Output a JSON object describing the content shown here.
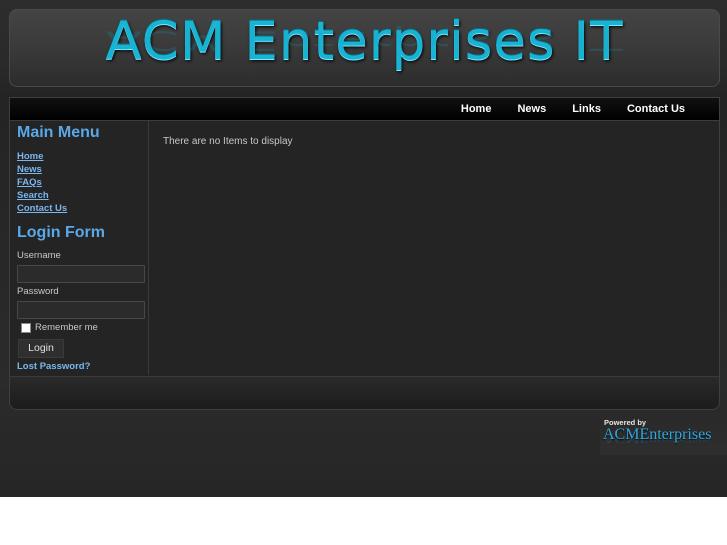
{
  "header": {
    "site_title": "ACM Enterprises IT"
  },
  "nav": {
    "items": [
      "Home",
      "News",
      "Links",
      "Contact Us"
    ]
  },
  "main_menu": {
    "title": "Main Menu",
    "items": [
      "Home",
      "News",
      "FAQs",
      "Search",
      "Contact Us"
    ]
  },
  "login_form": {
    "title": "Login Form",
    "username_label": "Username",
    "username_value": "",
    "password_label": "Password",
    "password_value": "",
    "remember_label": "Remember me",
    "remember_checked": false,
    "login_button": "Login",
    "lost_password": "Lost Password?"
  },
  "content": {
    "message": "There are no Items to display"
  },
  "footer": {
    "powered_by": "Powered by",
    "brand": "ACMEnterprises"
  },
  "colors": {
    "accent": "#18b4d4",
    "link": "#7ab7ef",
    "module_title": "#5aa8e8",
    "background": "#2a2a2a"
  }
}
